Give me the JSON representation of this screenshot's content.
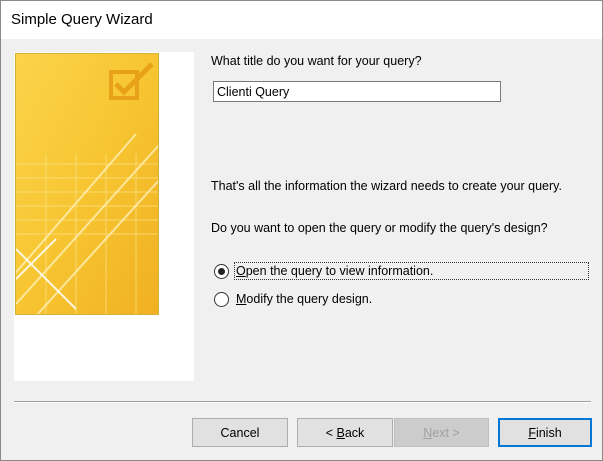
{
  "window": {
    "title": "Simple Query Wizard"
  },
  "form": {
    "title_prompt": "What title do you want for your query?",
    "title_value": "Clienti Query",
    "info_text": "That's all the information the wizard needs to create your query.",
    "open_prompt": "Do you want to open the query or modify the query's design?"
  },
  "options": {
    "open": {
      "accel": "O",
      "rest": "pen the query to view information.",
      "checked": true
    },
    "modify": {
      "accel": "M",
      "rest": "odify the query design.",
      "checked": false
    }
  },
  "buttons": {
    "cancel": "Cancel",
    "back_prefix": "< ",
    "back_accel": "B",
    "back_rest": "ack",
    "next_accel": "N",
    "next_rest": "ext >",
    "finish_accel": "F",
    "finish_rest": "inish"
  },
  "colors": {
    "accent": "#0078d7",
    "art_yellow": "#f7c531",
    "art_check": "#e8a21a"
  }
}
